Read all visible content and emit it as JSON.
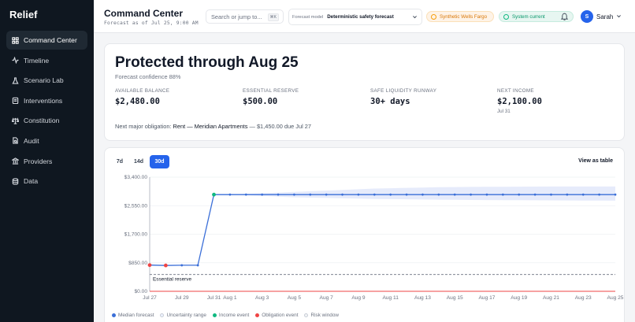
{
  "app": {
    "brand": "Relief"
  },
  "sidebar": {
    "items": [
      {
        "label": "Command Center",
        "icon": "grid-icon",
        "active": true
      },
      {
        "label": "Timeline",
        "icon": "activity-icon"
      },
      {
        "label": "Scenario Lab",
        "icon": "flask-icon"
      },
      {
        "label": "Interventions",
        "icon": "clipboard-icon"
      },
      {
        "label": "Constitution",
        "icon": "scale-icon"
      },
      {
        "label": "Audit",
        "icon": "file-search-icon"
      },
      {
        "label": "Providers",
        "icon": "bank-icon"
      },
      {
        "label": "Data",
        "icon": "database-icon"
      }
    ]
  },
  "header": {
    "title": "Command Center",
    "subtitle": "Forecast as of Jul 25, 9:00 AM",
    "search_placeholder": "Search or jump to...",
    "search_shortcut": "⌘K",
    "model_label": "Forecast model",
    "model_value": "Deterministic safety forecast",
    "badge_warn": "Synthetic Wells Fargo",
    "badge_ok": "System current",
    "user_initial": "S",
    "user_name": "Sarah"
  },
  "summary": {
    "headline": "Protected through Aug 25",
    "confidence": "Forecast confidence 88%",
    "stats": [
      {
        "label": "AVAILABLE BALANCE",
        "value": "$2,480.00",
        "sub": ""
      },
      {
        "label": "ESSENTIAL RESERVE",
        "value": "$500.00",
        "sub": ""
      },
      {
        "label": "SAFE LIQUIDITY RUNWAY",
        "value": "30+ days",
        "sub": ""
      },
      {
        "label": "NEXT INCOME",
        "value": "$2,100.00",
        "sub": "Jul 31"
      }
    ],
    "obligation_prefix": "Next major obligation:",
    "obligation_name": "Rent — Meridian Apartments",
    "obligation_detail": "— $1,450.00 due Jul 27"
  },
  "chart_controls": {
    "ranges": [
      "7d",
      "14d",
      "30d"
    ],
    "active_range": "30d",
    "view_table": "View as table"
  },
  "chart_data": {
    "type": "line",
    "x": [
      "Jul 27",
      "Jul 28",
      "Jul 29",
      "Jul 30",
      "Jul 31",
      "Aug 1",
      "Aug 2",
      "Aug 3",
      "Aug 4",
      "Aug 5",
      "Aug 6",
      "Aug 7",
      "Aug 8",
      "Aug 9",
      "Aug 10",
      "Aug 11",
      "Aug 12",
      "Aug 13",
      "Aug 14",
      "Aug 15",
      "Aug 16",
      "Aug 17",
      "Aug 18",
      "Aug 19",
      "Aug 20",
      "Aug 21",
      "Aug 22",
      "Aug 23",
      "Aug 24",
      "Aug 25"
    ],
    "x_tick_labels": [
      "Jul 27",
      "Jul 29",
      "Jul 31",
      "Aug 1",
      "Aug 3",
      "Aug 5",
      "Aug 7",
      "Aug 9",
      "Aug 11",
      "Aug 13",
      "Aug 15",
      "Aug 17",
      "Aug 19",
      "Aug 21",
      "Aug 23",
      "Aug 25"
    ],
    "series": [
      {
        "name": "Median forecast",
        "color": "#3b6fd8",
        "values": [
          780,
          770,
          775,
          775,
          2880,
          2880,
          2880,
          2880,
          2880,
          2880,
          2880,
          2880,
          2880,
          2880,
          2880,
          2880,
          2880,
          2880,
          2880,
          2880,
          2880,
          2880,
          2880,
          2880,
          2880,
          2880,
          2880,
          2880,
          2880,
          2880
        ]
      },
      {
        "name": "Uncertainty range",
        "color": "#e6ebfb",
        "lower": [
          780,
          770,
          775,
          775,
          2880,
          2880,
          2860,
          2840,
          2820,
          2800,
          2790,
          2780,
          2770,
          2760,
          2750,
          2745,
          2740,
          2735,
          2730,
          2725,
          2720,
          2718,
          2715,
          2712,
          2710,
          2708,
          2706,
          2704,
          2702,
          2700
        ],
        "upper": [
          780,
          770,
          775,
          775,
          2880,
          2880,
          2900,
          2920,
          2940,
          2960,
          2980,
          3000,
          3020,
          3040,
          3060,
          3070,
          3080,
          3090,
          3100,
          3105,
          3110,
          3112,
          3114,
          3116,
          3118,
          3120,
          3120,
          3120,
          3120,
          3120
        ]
      }
    ],
    "income_events": [
      {
        "x": "Jul 31",
        "y": 2880
      }
    ],
    "obligation_events": [
      {
        "x": "Jul 27",
        "y": 780
      },
      {
        "x": "Jul 28",
        "y": 770
      }
    ],
    "reference_line": {
      "label": "Essential reserve",
      "y": 500
    },
    "y_ticks": [
      "$0.00",
      "$850.00",
      "$1,700.00",
      "$2,550.00",
      "$3,400.00"
    ],
    "ylim": [
      0,
      3400
    ],
    "legend": [
      "Median forecast",
      "Uncertainty range",
      "Income event",
      "Obligation event",
      "Risk window"
    ],
    "colors": {
      "income": "#10b981",
      "obligation": "#ef4444",
      "risk": "#d1d5db",
      "reserve": "#6b7280"
    },
    "grid": true
  }
}
